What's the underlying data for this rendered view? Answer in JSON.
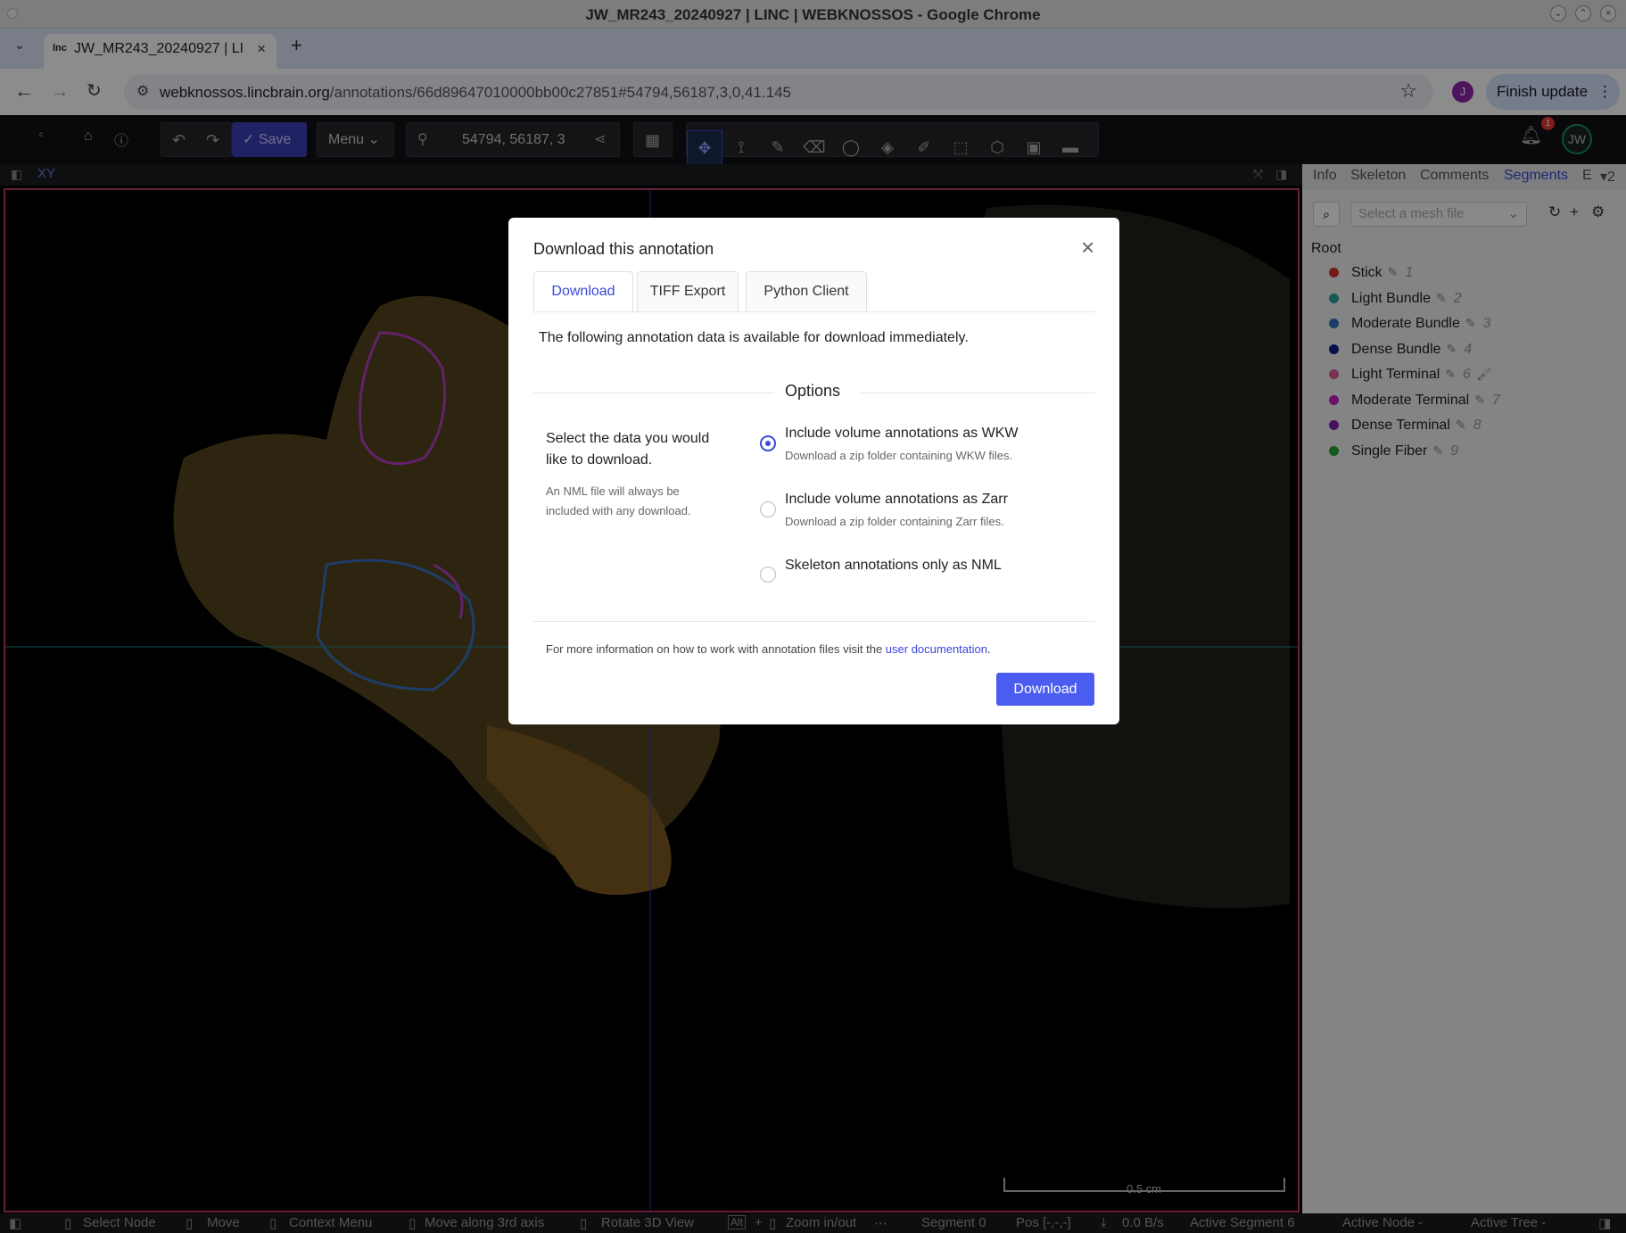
{
  "window": {
    "title": "JW_MR243_20240927 | LINC | WEBKNOSSOS - Google Chrome"
  },
  "browser": {
    "tab_title": "JW_MR243_20240927 | LINC | WEBKNOSSOS",
    "tab_favicon": "lnc",
    "url_host": "webknossos.lincbrain.org",
    "url_path": "/annotations/66d89647010000bb00c27851#54794,56187,3,0,41.145",
    "profile_initial": "J",
    "finish_update_label": "Finish update"
  },
  "toolbar": {
    "save_label": "Save",
    "menu_label": "Menu",
    "position_value": "54794, 56187, 3",
    "notification_count": "1",
    "user_initials": "JW"
  },
  "viewport": {
    "plane_label": "XY",
    "scale_label": "0.5 cm"
  },
  "right_panel": {
    "tabs": [
      "Info",
      "Skeleton",
      "Comments",
      "Segments",
      "E"
    ],
    "active_tab": "Segments",
    "tab_overflow_count": "2",
    "mesh_placeholder": "Select a mesh file",
    "root_label": "Root",
    "segments": [
      {
        "name": "Stick",
        "id": "1",
        "color": "#d32f2f"
      },
      {
        "name": "Light Bundle",
        "id": "2",
        "color": "#26a69a"
      },
      {
        "name": "Moderate Bundle",
        "id": "3",
        "color": "#2f6fbe"
      },
      {
        "name": "Dense Bundle",
        "id": "4",
        "color": "#0d1f8a"
      },
      {
        "name": "Light Terminal",
        "id": "6",
        "color": "#e0599b"
      },
      {
        "name": "Moderate Terminal",
        "id": "7",
        "color": "#c21fc4"
      },
      {
        "name": "Dense Terminal",
        "id": "8",
        "color": "#7e22a8"
      },
      {
        "name": "Single Fiber",
        "id": "9",
        "color": "#1fa832"
      }
    ]
  },
  "statusbar": {
    "items": [
      "Select Node",
      "Move",
      "Context Menu",
      "Move along 3rd axis",
      "Rotate 3D View",
      "Zoom in/out",
      "Segment 0",
      "Pos [-,-,-]",
      "0.0 B/s",
      "Active Segment 6",
      "Active Node -",
      "Active Tree -"
    ]
  },
  "modal": {
    "title": "Download this annotation",
    "tabs": [
      "Download",
      "TIFF Export",
      "Python Client"
    ],
    "intro": "The following annotation data is available for download immediately.",
    "options_title": "Options",
    "left_text": "Select the data you would like to download.",
    "left_small": "An NML file will always be included with any download.",
    "options": [
      {
        "label": "Include volume annotations as WKW",
        "desc": "Download a zip folder containing WKW files.",
        "selected": true
      },
      {
        "label": "Include volume annotations as Zarr",
        "desc": "Download a zip folder containing Zarr files.",
        "selected": false
      },
      {
        "label": "Skeleton annotations only as NML",
        "desc": "",
        "selected": false
      }
    ],
    "more_info_prefix": "For more information on how to work with annotation files visit the ",
    "more_info_link": "user documentation",
    "more_info_suffix": ".",
    "download_label": "Download"
  }
}
